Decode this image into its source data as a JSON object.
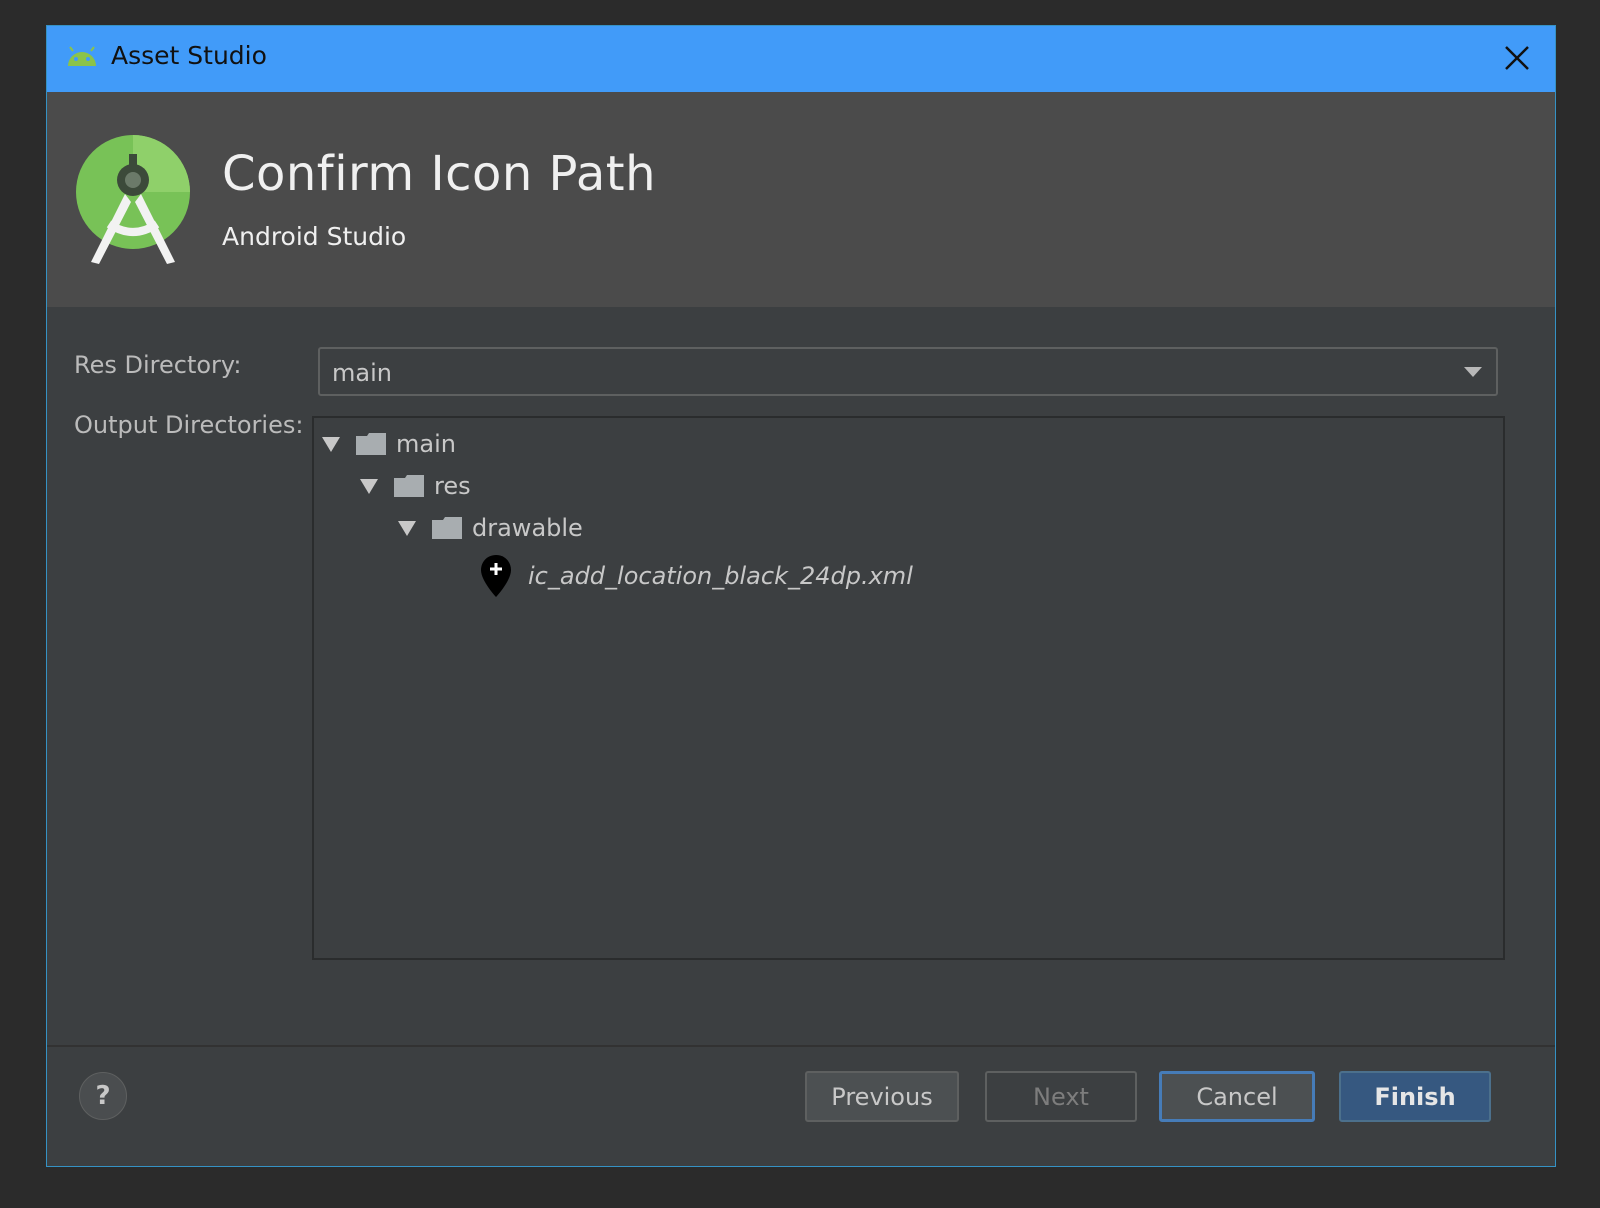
{
  "window": {
    "title": "Asset Studio"
  },
  "header": {
    "title": "Confirm Icon Path",
    "subtitle": "Android Studio"
  },
  "form": {
    "res_directory_label": "Res Directory:",
    "res_directory_value": "main",
    "output_directories_label": "Output Directories:"
  },
  "tree": {
    "items": [
      {
        "label": "main",
        "type": "folder",
        "expanded": true
      },
      {
        "label": "res",
        "type": "folder",
        "expanded": true
      },
      {
        "label": "drawable",
        "type": "folder",
        "expanded": true
      },
      {
        "label": "ic_add_location_black_24dp.xml",
        "type": "file",
        "icon": "add-location-icon"
      }
    ]
  },
  "footer": {
    "help_label": "?",
    "previous_label": "Previous",
    "next_label": "Next",
    "cancel_label": "Cancel",
    "finish_label": "Finish"
  },
  "colors": {
    "titlebar": "#419bf9",
    "header_bg": "#4b4b4b",
    "body_bg": "#3c3f41",
    "android_green": "#78c257"
  }
}
